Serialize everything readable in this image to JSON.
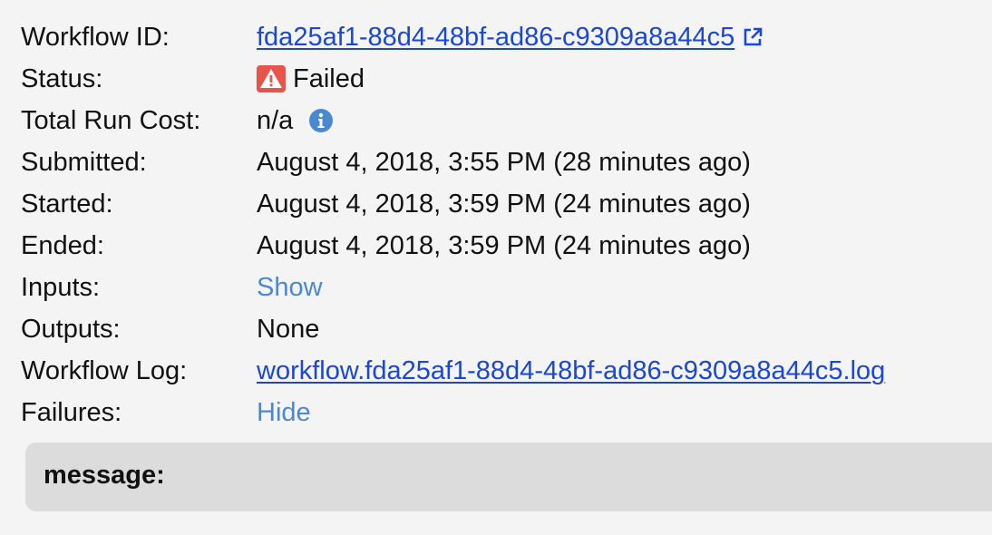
{
  "details": {
    "workflow_id": {
      "label": "Workflow ID:",
      "value": "fda25af1-88d4-48bf-ad86-c9309a8a44c5",
      "icon": "external-link-icon"
    },
    "status": {
      "label": "Status:",
      "value": "Failed",
      "icon": "warning-icon",
      "icon_color": "#e8534a"
    },
    "total_run_cost": {
      "label": "Total Run Cost:",
      "value": "n/a",
      "icon": "info-icon",
      "icon_color": "#4a89cf"
    },
    "submitted": {
      "label": "Submitted:",
      "value": "August 4, 2018, 3:55 PM (28 minutes ago)"
    },
    "started": {
      "label": "Started:",
      "value": "August 4, 2018, 3:59 PM (24 minutes ago)"
    },
    "ended": {
      "label": "Ended:",
      "value": "August 4, 2018, 3:59 PM (24 minutes ago)"
    },
    "inputs": {
      "label": "Inputs:",
      "toggle": "Show"
    },
    "outputs": {
      "label": "Outputs:",
      "value": "None"
    },
    "workflow_log": {
      "label": "Workflow Log:",
      "value": "workflow.fda25af1-88d4-48bf-ad86-c9309a8a44c5.log"
    },
    "failures": {
      "label": "Failures:",
      "toggle": "Hide"
    }
  },
  "failure_message": {
    "label": "message:"
  },
  "colors": {
    "link": "#1a47d6",
    "toggle": "#4a89cf",
    "background": "#f4f4f4",
    "message_box": "#dcdcdc"
  }
}
